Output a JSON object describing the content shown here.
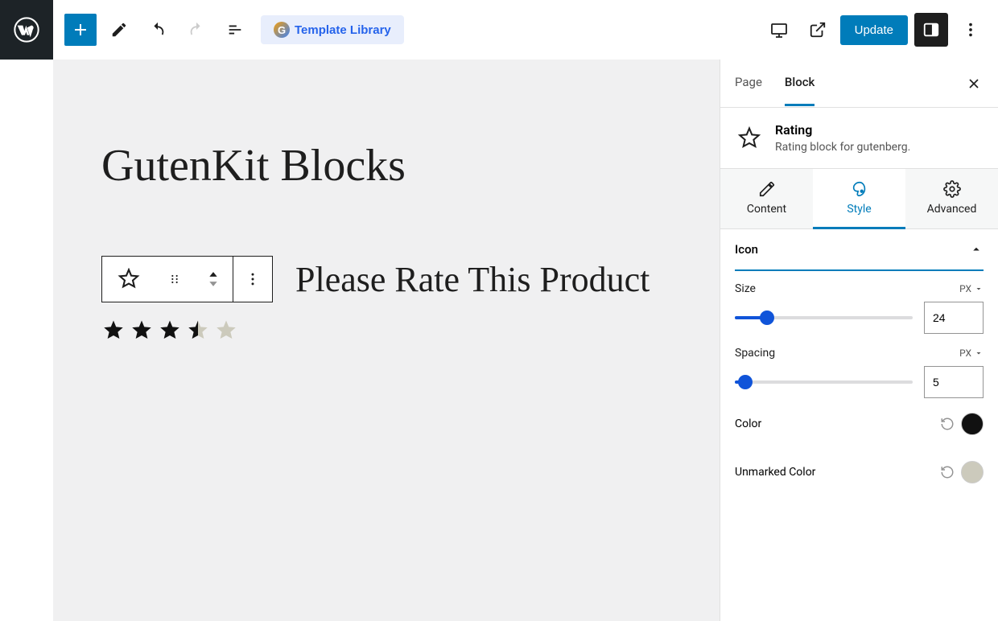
{
  "topbar": {
    "template_library": "Template Library",
    "update": "Update"
  },
  "canvas": {
    "heading": "GutenKit Blocks",
    "rate_text": "Please Rate This Product",
    "rating_value": 3.5,
    "rating_max": 5
  },
  "sidebar": {
    "tabs": {
      "page": "Page",
      "block": "Block"
    },
    "block_header": {
      "title": "Rating",
      "desc": "Rating block for gutenberg."
    },
    "subtabs": {
      "content": "Content",
      "style": "Style",
      "advanced": "Advanced"
    },
    "panel": {
      "title": "Icon",
      "size": {
        "label": "Size",
        "unit": "PX",
        "value": "24",
        "fill_pct": 18
      },
      "spacing": {
        "label": "Spacing",
        "unit": "PX",
        "value": "5",
        "fill_pct": 6
      },
      "color": {
        "label": "Color",
        "value": "#111111"
      },
      "unmarked": {
        "label": "Unmarked Color",
        "value": "#cccabc"
      }
    }
  }
}
